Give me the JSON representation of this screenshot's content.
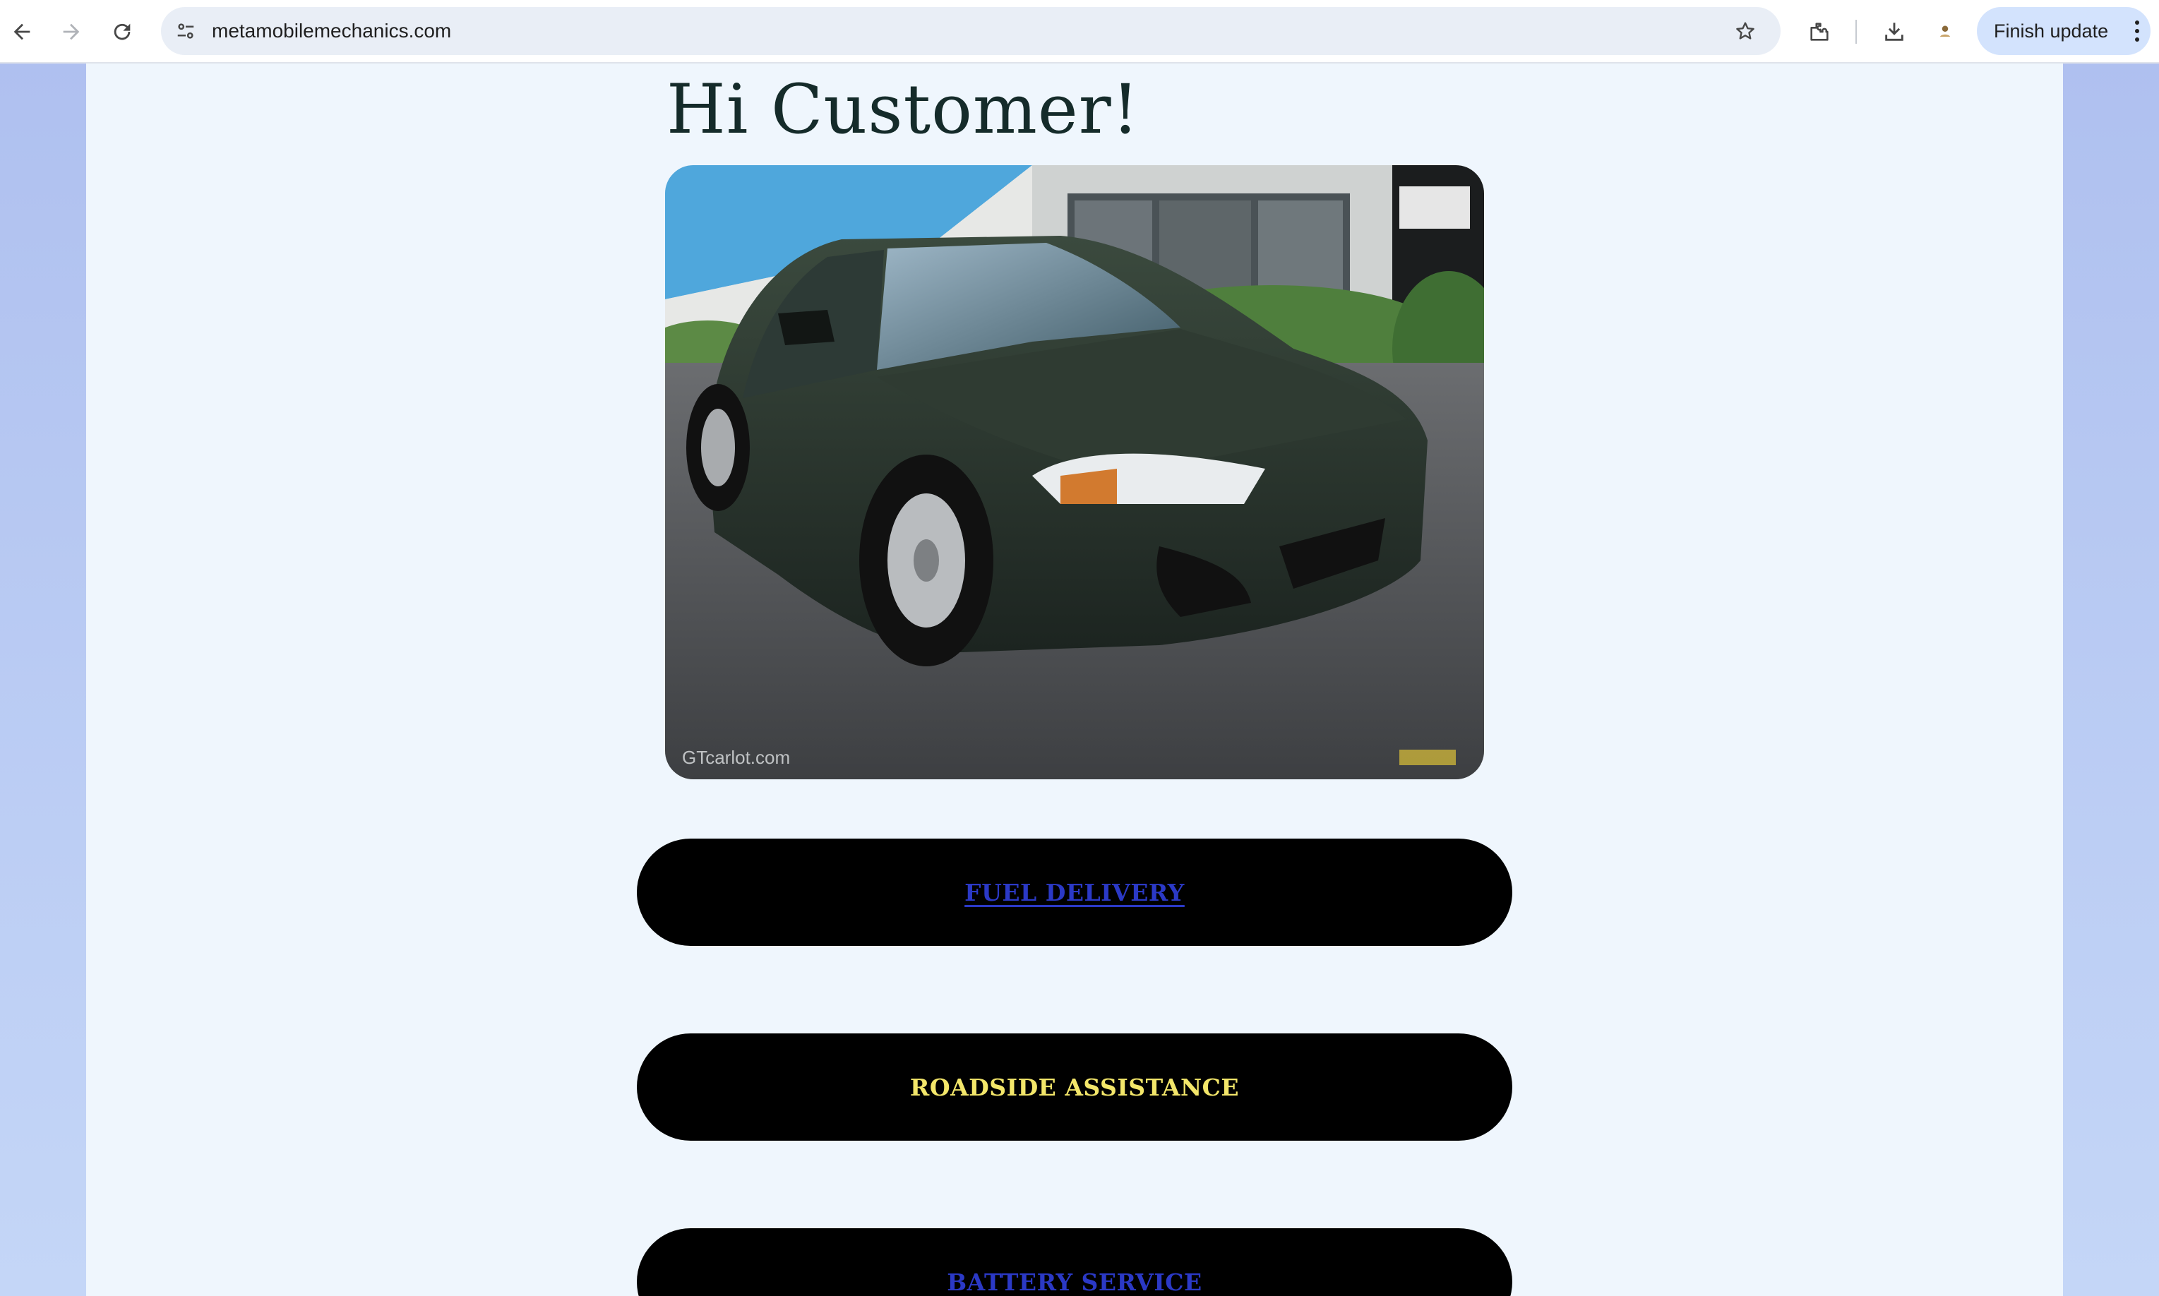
{
  "browser": {
    "url": "metamobilemechanics.com",
    "update_button_label": "Finish update"
  },
  "page": {
    "greeting": "Hi Customer!",
    "image_watermark": "GTcarlot.com",
    "services": [
      {
        "label": "FUEL DELIVERY"
      },
      {
        "label": "ROADSIDE ASSISTANCE"
      },
      {
        "label": "BATTERY SERVICE"
      }
    ]
  },
  "colors": {
    "page_background": "#eff6fd",
    "button_background": "#000000",
    "link_blue": "#2b39c6",
    "accent_yellow": "#f3e66a",
    "heading": "#152b2a"
  }
}
